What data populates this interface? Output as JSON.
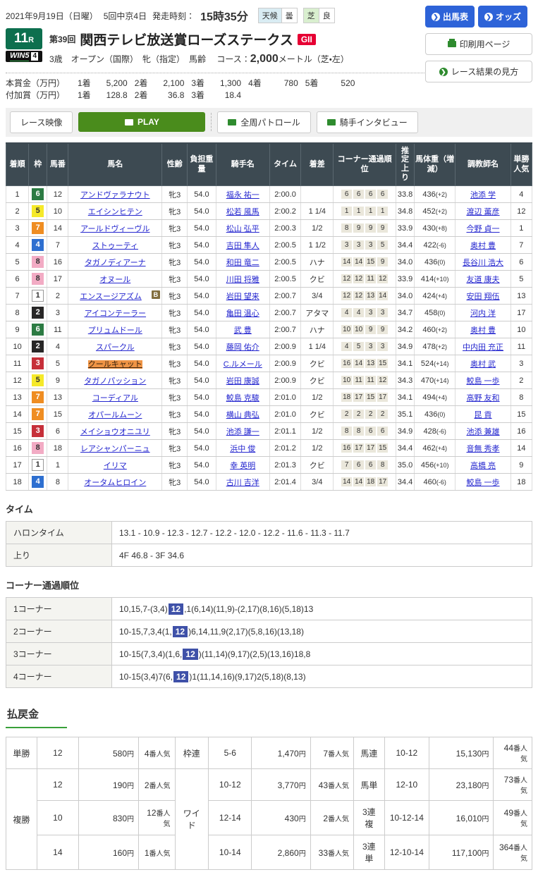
{
  "header": {
    "date": "2021年9月19日（日曜）",
    "meeting": "5回中京4日",
    "start_label": "発走時刻：",
    "start_time": "15時35分",
    "weather_label": "天候",
    "weather_value": "曇",
    "turf_label": "芝",
    "turf_value": "良",
    "btn_entry": "出馬表",
    "btn_odds": "オッズ",
    "btn_print": "印刷用ページ",
    "btn_guide": "レース結果の見方"
  },
  "race": {
    "number": "11",
    "number_suffix": "R",
    "win5": "WIN5",
    "win5_num": "4",
    "round": "第39回",
    "title": "関西テレビ放送賞ローズステークス",
    "grade": "GII",
    "conditions": "3歳　オープン（国際）　牝（指定）　馬齢",
    "course_label": "コース：",
    "course_num": "2,000",
    "course_suffix": "メートル（芝・左）"
  },
  "prize": {
    "hon": {
      "label": "本賞金（万円）",
      "items": [
        [
          "1着",
          "5,200"
        ],
        [
          "2着",
          "2,100"
        ],
        [
          "3着",
          "1,300"
        ],
        [
          "4着",
          "780"
        ],
        [
          "5着",
          "520"
        ]
      ]
    },
    "fuka": {
      "label": "付加賞（万円）",
      "items": [
        [
          "1着",
          "128.8"
        ],
        [
          "2着",
          "36.8"
        ],
        [
          "3着",
          "18.4"
        ]
      ]
    }
  },
  "video": {
    "watch": "レース映像",
    "play": "PLAY",
    "patrol": "全周パトロール",
    "interview": "騎手インタビュー"
  },
  "results": {
    "columns": {
      "pos": "着順",
      "waku": "枠",
      "num": "馬番",
      "name": "馬名",
      "sexage": "性齢",
      "weight": "負担重量",
      "jockey": "騎手名",
      "time": "タイム",
      "margin": "着差",
      "corner": "コーナー通過順位",
      "agari": "推定上り",
      "bw": "馬体重（増減）",
      "trainer": "調教師名",
      "pop": "単勝人気"
    },
    "rows": [
      {
        "pos": "1",
        "fk": "6",
        "num": "12",
        "name": "アンドヴァラナウト",
        "b": "",
        "hl": "",
        "sa": "牝3",
        "wt": "54.0",
        "jockey": "福永 祐一",
        "time": "2:00.0",
        "margin": "",
        "c1": "6",
        "c2": "6",
        "c3": "6",
        "c4": "6",
        "agari": "33.8",
        "bw": "436",
        "bwd": "(+2)",
        "trainer": "池添 学",
        "pop": "4"
      },
      {
        "pos": "2",
        "fk": "5",
        "num": "10",
        "name": "エイシンヒテン",
        "b": "",
        "hl": "",
        "sa": "牝3",
        "wt": "54.0",
        "jockey": "松若 風馬",
        "time": "2:00.2",
        "margin": "1 1/4",
        "c1": "1",
        "c2": "1",
        "c3": "1",
        "c4": "1",
        "agari": "34.8",
        "bw": "452",
        "bwd": "(+2)",
        "trainer": "渡辺 薫彦",
        "pop": "12"
      },
      {
        "pos": "3",
        "fk": "7",
        "num": "14",
        "name": "アールドヴィーヴル",
        "b": "",
        "hl": "",
        "sa": "牝3",
        "wt": "54.0",
        "jockey": "松山 弘平",
        "time": "2:00.3",
        "margin": "1/2",
        "c1": "8",
        "c2": "9",
        "c3": "9",
        "c4": "9",
        "agari": "33.9",
        "bw": "430",
        "bwd": "(+8)",
        "trainer": "今野 貞一",
        "pop": "1"
      },
      {
        "pos": "4",
        "fk": "4",
        "num": "7",
        "name": "ストゥーティ",
        "b": "",
        "hl": "",
        "sa": "牝3",
        "wt": "54.0",
        "jockey": "吉田 隼人",
        "time": "2:00.5",
        "margin": "1 1/2",
        "c1": "3",
        "c2": "3",
        "c3": "3",
        "c4": "5",
        "agari": "34.4",
        "bw": "422",
        "bwd": "(-6)",
        "trainer": "奥村 豊",
        "pop": "7"
      },
      {
        "pos": "5",
        "fk": "8",
        "num": "16",
        "name": "タガノディアーナ",
        "b": "",
        "hl": "",
        "sa": "牝3",
        "wt": "54.0",
        "jockey": "和田 竜二",
        "time": "2:00.5",
        "margin": "ハナ",
        "c1": "14",
        "c2": "14",
        "c3": "15",
        "c4": "9",
        "agari": "34.0",
        "bw": "436",
        "bwd": "(0)",
        "trainer": "長谷川 浩大",
        "pop": "6"
      },
      {
        "pos": "6",
        "fk": "8",
        "num": "17",
        "name": "オヌール",
        "b": "",
        "hl": "",
        "sa": "牝3",
        "wt": "54.0",
        "jockey": "川田 将雅",
        "time": "2:00.5",
        "margin": "クビ",
        "c1": "12",
        "c2": "12",
        "c3": "11",
        "c4": "12",
        "agari": "33.9",
        "bw": "414",
        "bwd": "(+10)",
        "trainer": "友道 康夫",
        "pop": "5"
      },
      {
        "pos": "7",
        "fk": "1",
        "num": "2",
        "name": "エンスージアズム",
        "b": "B",
        "hl": "",
        "sa": "牝3",
        "wt": "54.0",
        "jockey": "岩田 望来",
        "time": "2:00.7",
        "margin": "3/4",
        "c1": "12",
        "c2": "12",
        "c3": "13",
        "c4": "14",
        "agari": "34.0",
        "bw": "424",
        "bwd": "(+4)",
        "trainer": "安田 翔伍",
        "pop": "13"
      },
      {
        "pos": "8",
        "fk": "2",
        "num": "3",
        "name": "アイコンテーラー",
        "b": "",
        "hl": "",
        "sa": "牝3",
        "wt": "54.0",
        "jockey": "亀田 温心",
        "time": "2:00.7",
        "margin": "アタマ",
        "c1": "4",
        "c2": "4",
        "c3": "3",
        "c4": "3",
        "agari": "34.7",
        "bw": "458",
        "bwd": "(0)",
        "trainer": "河内 洋",
        "pop": "17"
      },
      {
        "pos": "9",
        "fk": "6",
        "num": "11",
        "name": "プリュムドール",
        "b": "",
        "hl": "",
        "sa": "牝3",
        "wt": "54.0",
        "jockey": "武 豊",
        "time": "2:00.7",
        "margin": "ハナ",
        "c1": "10",
        "c2": "10",
        "c3": "9",
        "c4": "9",
        "agari": "34.2",
        "bw": "460",
        "bwd": "(+2)",
        "trainer": "奥村 豊",
        "pop": "10"
      },
      {
        "pos": "10",
        "fk": "2",
        "num": "4",
        "name": "スパークル",
        "b": "",
        "hl": "",
        "sa": "牝3",
        "wt": "54.0",
        "jockey": "藤岡 佑介",
        "time": "2:00.9",
        "margin": "1 1/4",
        "c1": "4",
        "c2": "5",
        "c3": "3",
        "c4": "3",
        "agari": "34.9",
        "bw": "478",
        "bwd": "(+2)",
        "trainer": "中内田 充正",
        "pop": "11"
      },
      {
        "pos": "11",
        "fk": "3",
        "num": "5",
        "name": "クールキャット",
        "b": "",
        "hl": "1",
        "sa": "牝3",
        "wt": "54.0",
        "jockey": "C.ルメール",
        "time": "2:00.9",
        "margin": "クビ",
        "c1": "16",
        "c2": "14",
        "c3": "13",
        "c4": "15",
        "agari": "34.1",
        "bw": "524",
        "bwd": "(+14)",
        "trainer": "奥村 武",
        "pop": "3"
      },
      {
        "pos": "12",
        "fk": "5",
        "num": "9",
        "name": "タガノパッション",
        "b": "",
        "hl": "",
        "sa": "牝3",
        "wt": "54.0",
        "jockey": "岩田 康誠",
        "time": "2:00.9",
        "margin": "クビ",
        "c1": "10",
        "c2": "11",
        "c3": "11",
        "c4": "12",
        "agari": "34.3",
        "bw": "470",
        "bwd": "(+14)",
        "trainer": "鮫島 一歩",
        "pop": "2"
      },
      {
        "pos": "13",
        "fk": "7",
        "num": "13",
        "name": "コーディアル",
        "b": "",
        "hl": "",
        "sa": "牝3",
        "wt": "54.0",
        "jockey": "鮫島 克駿",
        "time": "2:01.0",
        "margin": "1/2",
        "c1": "18",
        "c2": "17",
        "c3": "15",
        "c4": "17",
        "agari": "34.1",
        "bw": "494",
        "bwd": "(+4)",
        "trainer": "高野 友和",
        "pop": "8"
      },
      {
        "pos": "14",
        "fk": "7",
        "num": "15",
        "name": "オパールムーン",
        "b": "",
        "hl": "",
        "sa": "牝3",
        "wt": "54.0",
        "jockey": "横山 典弘",
        "time": "2:01.0",
        "margin": "クビ",
        "c1": "2",
        "c2": "2",
        "c3": "2",
        "c4": "2",
        "agari": "35.1",
        "bw": "436",
        "bwd": "(0)",
        "trainer": "昆 貢",
        "pop": "15"
      },
      {
        "pos": "15",
        "fk": "3",
        "num": "6",
        "name": "メイショウオニユリ",
        "b": "",
        "hl": "",
        "sa": "牝3",
        "wt": "54.0",
        "jockey": "池添 謙一",
        "time": "2:01.1",
        "margin": "1/2",
        "c1": "8",
        "c2": "8",
        "c3": "6",
        "c4": "6",
        "agari": "34.9",
        "bw": "428",
        "bwd": "(-6)",
        "trainer": "池添 兼雄",
        "pop": "16"
      },
      {
        "pos": "16",
        "fk": "8",
        "num": "18",
        "name": "レアシャンパーニュ",
        "b": "",
        "hl": "",
        "sa": "牝3",
        "wt": "54.0",
        "jockey": "浜中 俊",
        "time": "2:01.2",
        "margin": "1/2",
        "c1": "16",
        "c2": "17",
        "c3": "17",
        "c4": "15",
        "agari": "34.4",
        "bw": "462",
        "bwd": "(+4)",
        "trainer": "音無 秀孝",
        "pop": "14"
      },
      {
        "pos": "17",
        "fk": "1",
        "num": "1",
        "name": "イリマ",
        "b": "",
        "hl": "",
        "sa": "牝3",
        "wt": "54.0",
        "jockey": "幸 英明",
        "time": "2:01.3",
        "margin": "クビ",
        "c1": "7",
        "c2": "6",
        "c3": "6",
        "c4": "8",
        "agari": "35.0",
        "bw": "456",
        "bwd": "(+10)",
        "trainer": "高橋 亮",
        "pop": "9"
      },
      {
        "pos": "18",
        "fk": "4",
        "num": "8",
        "name": "オータムヒロイン",
        "b": "",
        "hl": "",
        "sa": "牝3",
        "wt": "54.0",
        "jockey": "古川 吉洋",
        "time": "2:01.4",
        "margin": "3/4",
        "c1": "14",
        "c2": "14",
        "c3": "18",
        "c4": "17",
        "agari": "34.4",
        "bw": "460",
        "bwd": "(-6)",
        "trainer": "鮫島 一歩",
        "pop": "18"
      }
    ]
  },
  "time_section": {
    "title": "タイム",
    "halon_label": "ハロンタイム",
    "halon": "13.1 - 10.9 - 12.3 - 12.7 - 12.2 - 12.0 - 12.2 - 11.6 - 11.3 - 11.7",
    "agari_label": "上り",
    "agari": "4F 46.8 - 3F 34.6"
  },
  "corner_section": {
    "title": "コーナー通過順位",
    "rows": [
      {
        "label": "1コーナー",
        "pre": "10,15,7-(3,4)",
        "hl": "12",
        "post": ",1(6,14)(11,9)-(2,17)(8,16)(5,18)13"
      },
      {
        "label": "2コーナー",
        "pre": "10-15,7,3,4(1,",
        "hl": "12",
        "post": ")6,14,11,9(2,17)(5,8,16)(13,18)"
      },
      {
        "label": "3コーナー",
        "pre": "10-15(7,3,4)(1,6,",
        "hl": "12",
        "post": ")(11,14)(9,17)(2,5)(13,16)18,8"
      },
      {
        "label": "4コーナー",
        "pre": "10-15(3,4)7(6,",
        "hl": "12",
        "post": ")1(11,14,16)(9,17)2(5,18)(8,13)"
      }
    ]
  },
  "payout": {
    "title": "払戻金",
    "yen_suffix": "円",
    "pop_suffix": "番人気",
    "tansho": {
      "label": "単勝",
      "num": "12",
      "yen": "580",
      "pop": "4"
    },
    "fukusho": {
      "label": "複勝",
      "rows": [
        {
          "num": "12",
          "yen": "190",
          "pop": "2"
        },
        {
          "num": "10",
          "yen": "830",
          "pop": "12"
        },
        {
          "num": "14",
          "yen": "160",
          "pop": "1"
        }
      ]
    },
    "wakuren": {
      "label": "枠連",
      "num": "5-6",
      "yen": "1,470",
      "pop": "7"
    },
    "wide": {
      "label": "ワイド",
      "rows": [
        {
          "num": "10-12",
          "yen": "3,770",
          "pop": "43"
        },
        {
          "num": "12-14",
          "yen": "430",
          "pop": "2"
        },
        {
          "num": "10-14",
          "yen": "2,860",
          "pop": "33"
        }
      ]
    },
    "umaren": {
      "label": "馬連",
      "num": "10-12",
      "yen": "15,130",
      "pop": "44"
    },
    "umatan": {
      "label": "馬単",
      "num": "12-10",
      "yen": "23,180",
      "pop": "73"
    },
    "sanrenpuku": {
      "label": "3連複",
      "num": "10-12-14",
      "yen": "16,010",
      "pop": "49"
    },
    "sanrentan": {
      "label": "3連単",
      "num": "12-10-14",
      "yen": "117,100",
      "pop": "364"
    }
  }
}
